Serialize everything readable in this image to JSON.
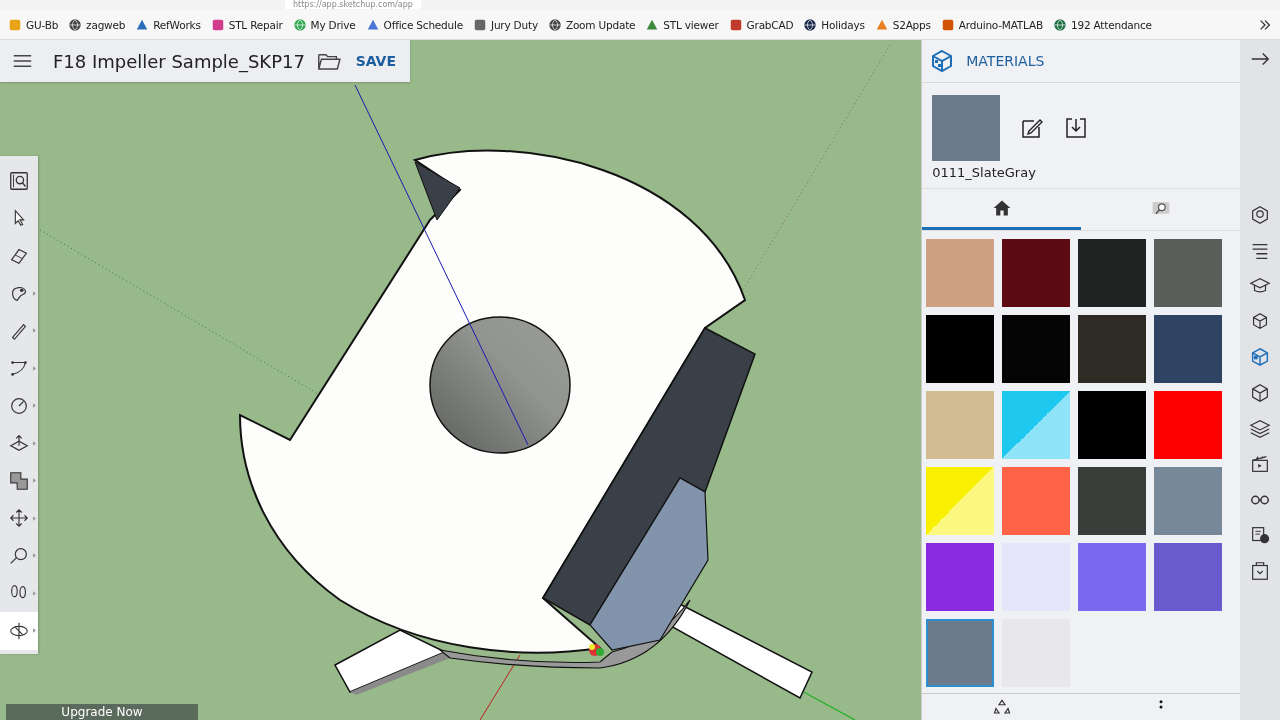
{
  "browser": {
    "url": "https://app.sketchup.com/app"
  },
  "bookmarks": [
    {
      "label": "GU-Bb",
      "color": "#e8a317"
    },
    {
      "label": "zagweb",
      "color": "#444444"
    },
    {
      "label": "RefWorks",
      "color": "#2a6ebb"
    },
    {
      "label": "STL Repair",
      "color": "#d23c8c"
    },
    {
      "label": "My Drive",
      "color": "#34a853"
    },
    {
      "label": "Office Schedule",
      "color": "#4a78d6"
    },
    {
      "label": "Jury Duty",
      "color": "#666666"
    },
    {
      "label": "Zoom Update",
      "color": "#444444"
    },
    {
      "label": "STL viewer",
      "color": "#3a8a3a"
    },
    {
      "label": "GrabCAD",
      "color": "#c0392b"
    },
    {
      "label": "Holidays",
      "color": "#1a2a4a"
    },
    {
      "label": "S2Apps",
      "color": "#e67e22"
    },
    {
      "label": "Arduino-MATLAB",
      "color": "#d35400"
    },
    {
      "label": "192 Attendance",
      "color": "#1e7145"
    }
  ],
  "header": {
    "title": "F18 Impeller Sample_SKP17",
    "save": "SAVE"
  },
  "tools": [
    {
      "selected": false
    },
    {
      "selected": false
    },
    {
      "selected": false
    },
    {
      "selected": false
    },
    {
      "selected": false
    },
    {
      "selected": false
    },
    {
      "selected": false
    },
    {
      "selected": false
    },
    {
      "selected": false
    },
    {
      "selected": false
    },
    {
      "selected": false
    },
    {
      "selected": false
    },
    {
      "selected": true
    }
  ],
  "upgrade": "Upgrade Now",
  "materials": {
    "title": "MATERIALS",
    "current": {
      "name": "0111_SlateGray",
      "color": "#6c7b8b"
    },
    "tabs": [
      {
        "kind": "home",
        "selected": true
      },
      {
        "kind": "browse",
        "selected": false
      }
    ],
    "swatches": [
      {
        "color": "#cfa184",
        "selected": false
      },
      {
        "color": "#5e0a14",
        "selected": false
      },
      {
        "color": "#1f2220",
        "selected": false
      },
      {
        "color": "#5b5d5a",
        "selected": false
      },
      {
        "color": "#000000",
        "selected": false
      },
      {
        "color": "#050505",
        "selected": false
      },
      {
        "color": "#2e2a24",
        "selected": false
      },
      {
        "color": "#2f4463",
        "selected": false
      },
      {
        "color": "#d2bc91",
        "selected": false
      },
      {
        "color": "#1ec8ef",
        "kind": "split",
        "selected": false
      },
      {
        "color": "#000000",
        "selected": false
      },
      {
        "color": "#ff0000",
        "selected": false
      },
      {
        "color": "#f8f000",
        "kind": "split",
        "selected": false
      },
      {
        "color": "#ff6347",
        "selected": false
      },
      {
        "color": "#3a3c3a",
        "selected": false
      },
      {
        "color": "#778899",
        "selected": false
      },
      {
        "color": "#8a2be2",
        "selected": false
      },
      {
        "color": "#e6e6fa",
        "selected": false
      },
      {
        "color": "#7b68ee",
        "selected": false
      },
      {
        "color": "#6a5acd",
        "selected": false
      },
      {
        "color": "#6c7b8b",
        "selected": true
      },
      {
        "color": "#e8e8ec",
        "selected": false
      }
    ]
  },
  "side_icons": [
    {
      "selected": false
    },
    {
      "selected": false
    },
    {
      "selected": false
    },
    {
      "selected": false
    },
    {
      "selected": true
    },
    {
      "selected": false
    },
    {
      "selected": false
    },
    {
      "selected": false
    },
    {
      "selected": false
    },
    {
      "selected": false
    },
    {
      "selected": false
    }
  ]
}
